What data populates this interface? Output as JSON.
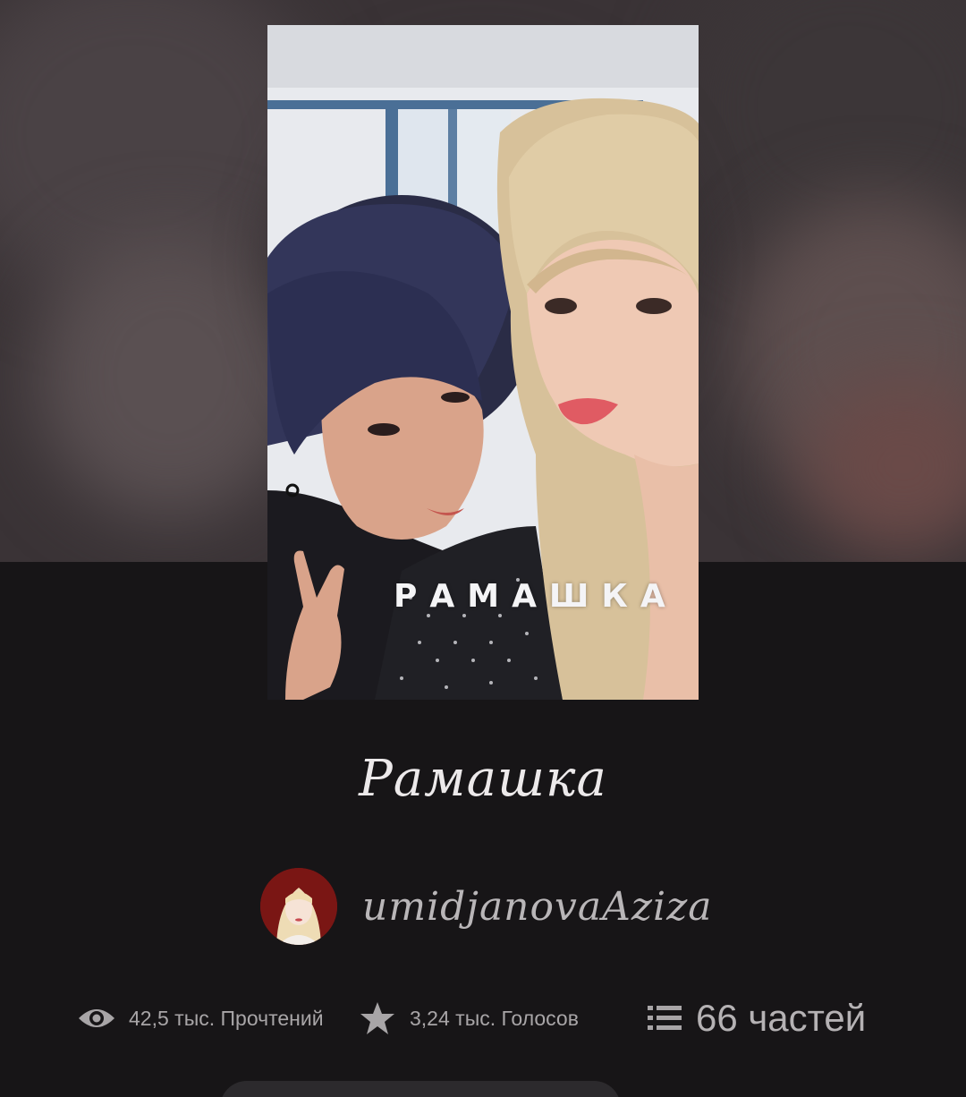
{
  "story": {
    "cover_title": "РАМАШКА",
    "title": "Рамашка",
    "author": "umidjanovaAziza"
  },
  "stats": {
    "reads": "42,5 тыс. Прочтений",
    "votes": "3,24 тыс. Голосов",
    "parts": "66 частей"
  },
  "icons": {
    "reads": "eye-icon",
    "votes": "star-icon",
    "parts": "list-icon"
  },
  "colors": {
    "background": "#171517",
    "text_primary": "#ece9ea",
    "text_secondary": "#a8a5a7"
  }
}
